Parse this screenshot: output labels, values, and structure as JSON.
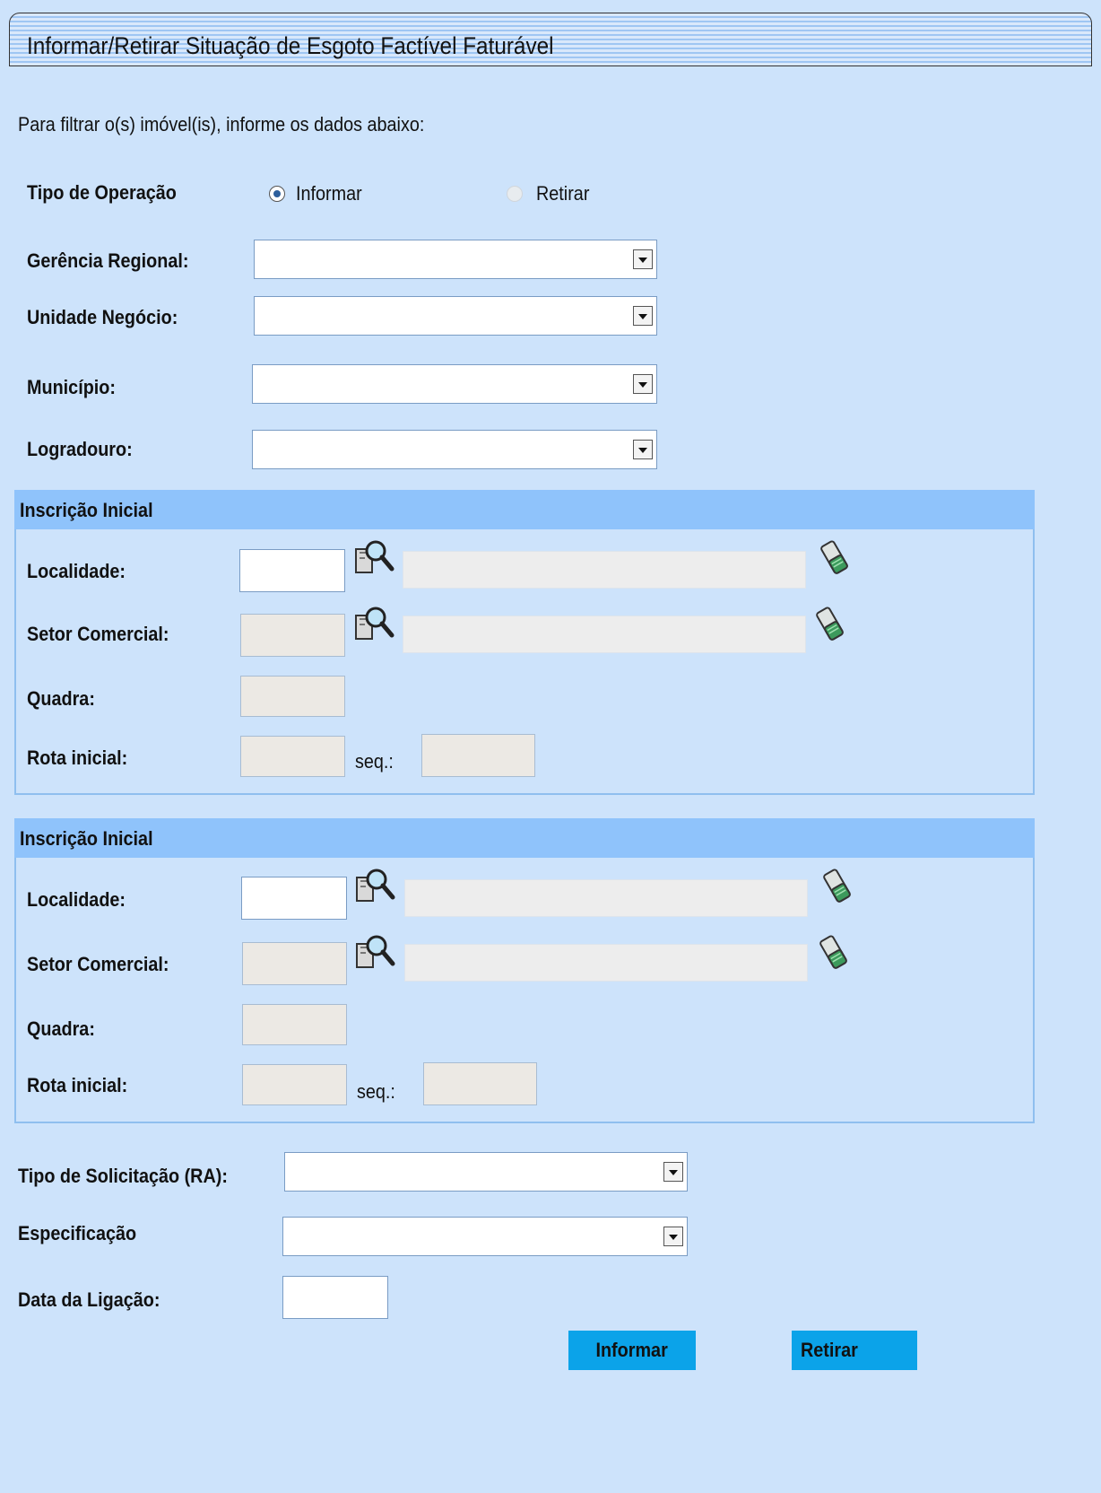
{
  "title": "Informar/Retirar Situação de Esgoto Factível Faturável",
  "intro": "Para filtrar o(s) imóvel(is), informe os dados abaixo:",
  "operation": {
    "label": "Tipo de  Operação",
    "options": [
      {
        "label": "Informar",
        "selected": true
      },
      {
        "label": "Retirar",
        "selected": false
      }
    ]
  },
  "filters": {
    "gerencia_label": "Gerência Regional:",
    "gerencia_value": "",
    "unidade_label": "Unidade Negócio:",
    "unidade_value": "",
    "municipio_label": "Município:",
    "municipio_value": "",
    "logradouro_label": "Logradouro:",
    "logradouro_value": ""
  },
  "inscricao_sections": [
    {
      "title": "Inscrição Inicial",
      "localidade_label": "Localidade:",
      "setor_label": "Setor Comercial:",
      "quadra_label": "Quadra:",
      "rota_label": "Rota inicial:",
      "seq_label": "seq.:"
    },
    {
      "title": "Inscrição Inicial",
      "localidade_label": "Localidade:",
      "setor_label": "Setor Comercial:",
      "quadra_label": "Quadra:",
      "rota_label": "Rota inicial:",
      "seq_label": "seq.:"
    }
  ],
  "bottom": {
    "tipo_solicitacao_label": "Tipo de Solicitação (RA):",
    "tipo_solicitacao_value": "",
    "especificacao_label": "Especificação",
    "especificacao_value": "",
    "data_ligacao_label": "Data da Ligação:",
    "data_ligacao_value": ""
  },
  "buttons": {
    "informar": "Informar",
    "retirar": "Retirar"
  },
  "icons": {
    "search": "magnifier-document-icon",
    "clear": "eraser-icon"
  },
  "colors": {
    "page_bg": "#cde3fb",
    "section_header": "#8fc3fb",
    "button": "#0ba3e9"
  }
}
